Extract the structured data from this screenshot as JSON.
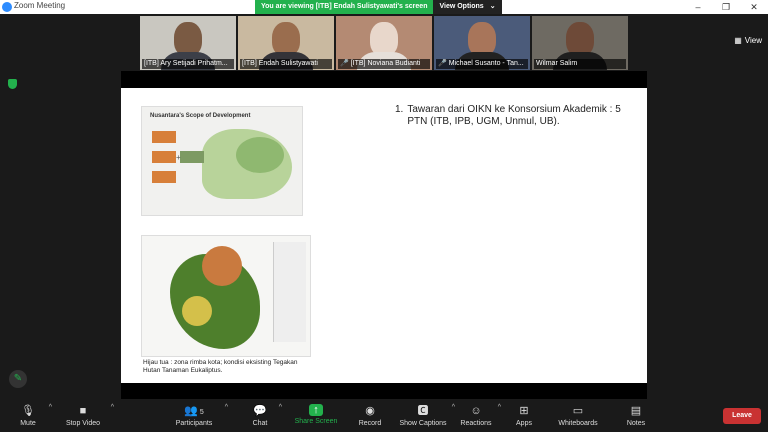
{
  "window": {
    "title": "Zoom Meeting",
    "controls": [
      "–",
      "❐",
      "✕"
    ]
  },
  "share_banner": {
    "text": "You are viewing [ITB] Endah Sulistyawati's screen",
    "options_label": "View Options",
    "caret": "⌄"
  },
  "gallery": {
    "view_label": "View",
    "participants": [
      {
        "name": "[ITB] Ary Setijadi Prihatm...",
        "muted": false,
        "bg": "#c9c7c0",
        "face": "#7a5a43",
        "shirt": "#3c3f48"
      },
      {
        "name": "[ITB] Endah Sulistyawati",
        "muted": false,
        "bg": "#c9b9a0",
        "face": "#9a6d4e",
        "shirt": "#343338"
      },
      {
        "name": "[ITB] Noviana Budianti",
        "muted": true,
        "bg": "#b48a73",
        "face": "#e8d7cb",
        "shirt": "#e6dfd9"
      },
      {
        "name": "Michael Susanto - Tan...",
        "muted": true,
        "bg": "#4b5b7a",
        "face": "#a8755a",
        "shirt": "#222"
      },
      {
        "name": "Wilmar Salim",
        "muted": false,
        "bg": "#6e6a62",
        "face": "#6e4a38",
        "shirt": "#1f1f1f"
      }
    ]
  },
  "slide": {
    "map_title": "Nusantara's Scope of Development",
    "list_number": "1.",
    "list_text": "Tawaran dari OIKN ke Konsorsium Akademik : 5 PTN (ITB, IPB, UGM, Unmul, UB).",
    "caption": "Hijau tua : zona rimba kota; kondisi eksisting Tegakan Hutan Tanaman Eukaliptus."
  },
  "toolbar": {
    "mute": "Mute",
    "stop_video": "Stop Video",
    "participants": "Participants",
    "participants_count": "5",
    "chat": "Chat",
    "share_screen": "Share Screen",
    "record": "Record",
    "show_captions": "Show Captions",
    "reactions": "Reactions",
    "apps": "Apps",
    "whiteboards": "Whiteboards",
    "notes": "Notes",
    "leave": "Leave"
  },
  "colors": {
    "accent_green": "#23b14d",
    "leave_red": "#c93232",
    "zoom_blue": "#2d8cff"
  }
}
